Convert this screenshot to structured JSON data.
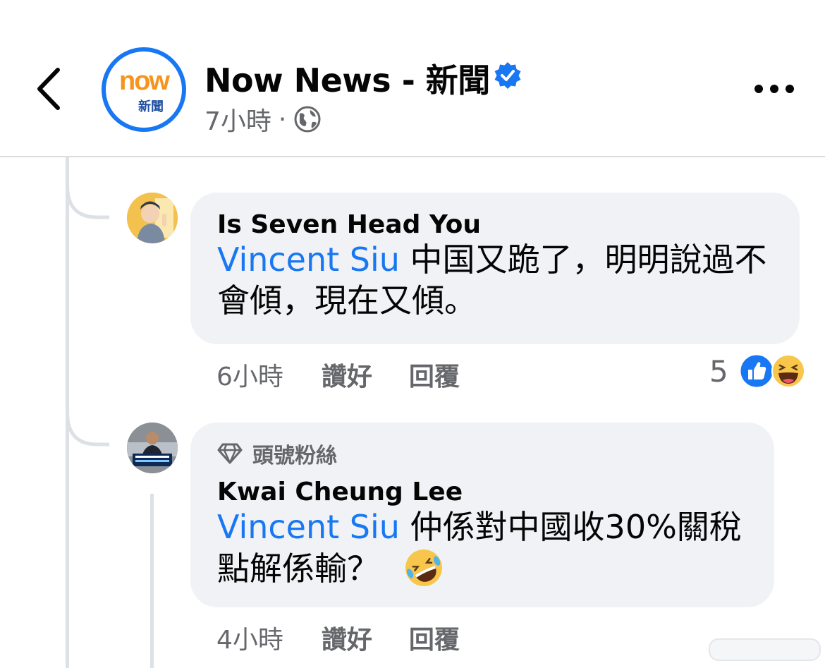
{
  "header": {
    "page_name": "Now News - 新聞",
    "logo_now": "now",
    "logo_sub": "新聞",
    "time": "7小時",
    "separator": "·",
    "icons": [
      "back-arrow-icon",
      "verified-badge-icon",
      "globe-icon",
      "more-icon"
    ]
  },
  "thread": {
    "cut_off_text": "·  ·  ·  ·  ·"
  },
  "comments": [
    {
      "author": "Is Seven Head You",
      "mention": "Vincent Siu",
      "text": " 中国又跪了，明明說過不會傾，現在又傾。",
      "time": "6小時",
      "like_label": "讚好",
      "reply_label": "回覆",
      "reaction_count": "5",
      "reaction_icons": [
        "like-icon",
        "haha-icon"
      ]
    },
    {
      "badge": "頭號粉絲",
      "badge_icon": "diamond-icon",
      "author": "Kwai Cheung Lee",
      "mention": "Vincent Siu",
      "text": " 仲係對中國收30%關稅 點解係輸？",
      "emoji": "🤣",
      "time": "4小時",
      "like_label": "讚好",
      "reply_label": "回覆"
    }
  ],
  "colors": {
    "brand_blue": "#1877f2",
    "bubble_bg": "#f0f2f5",
    "secondary_text": "#65676b",
    "now_orange": "#f7941d",
    "haha_yellow": "#f7c64a"
  }
}
